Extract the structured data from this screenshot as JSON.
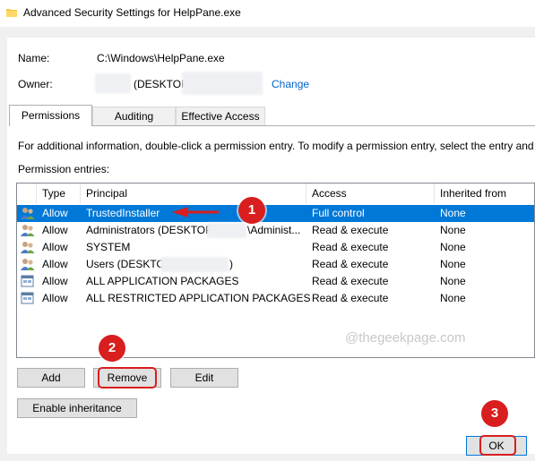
{
  "window": {
    "title": "Advanced Security Settings for HelpPane.exe"
  },
  "info": {
    "name_label": "Name:",
    "name_value": "C:\\Windows\\HelpPane.exe",
    "owner_label": "Owner:",
    "owner_value_prefix": "(DESKTOP",
    "change_link": "Change"
  },
  "tabs": [
    {
      "label": "Permissions",
      "active": true
    },
    {
      "label": "Auditing",
      "active": false
    },
    {
      "label": "Effective Access",
      "active": false
    }
  ],
  "info_text": "For additional information, double-click a permission entry. To modify a permission entry, select the entry and",
  "entries_label": "Permission entries:",
  "columns": {
    "type": "Type",
    "principal": "Principal",
    "access": "Access",
    "inherited": "Inherited from"
  },
  "rows": [
    {
      "type": "Allow",
      "principal": "TrustedInstaller",
      "access": "Full control",
      "inherited": "None",
      "selected": true
    },
    {
      "type": "Allow",
      "principal": "Administrators (DESKTOP",
      "principal_suffix": "\\Administ...",
      "access": "Read & execute",
      "inherited": "None"
    },
    {
      "type": "Allow",
      "principal": "SYSTEM",
      "access": "Read & execute",
      "inherited": "None"
    },
    {
      "type": "Allow",
      "principal": "Users (DESKTOP",
      "principal_suffix": ")",
      "access": "Read & execute",
      "inherited": "None"
    },
    {
      "type": "Allow",
      "principal": "ALL APPLICATION PACKAGES",
      "access": "Read & execute",
      "inherited": "None"
    },
    {
      "type": "Allow",
      "principal": "ALL RESTRICTED APPLICATION PACKAGES",
      "access": "Read & execute",
      "inherited": "None"
    }
  ],
  "buttons": {
    "add": "Add",
    "remove": "Remove",
    "edit": "Edit",
    "enable_inheritance": "Enable inheritance",
    "ok": "OK"
  },
  "annotations": {
    "step1": "1",
    "step2": "2",
    "step3": "3"
  },
  "watermark": "@thegeekpage.com",
  "colors": {
    "selection": "#0078d7",
    "link": "#0066cc",
    "callout": "#d81e1e"
  }
}
